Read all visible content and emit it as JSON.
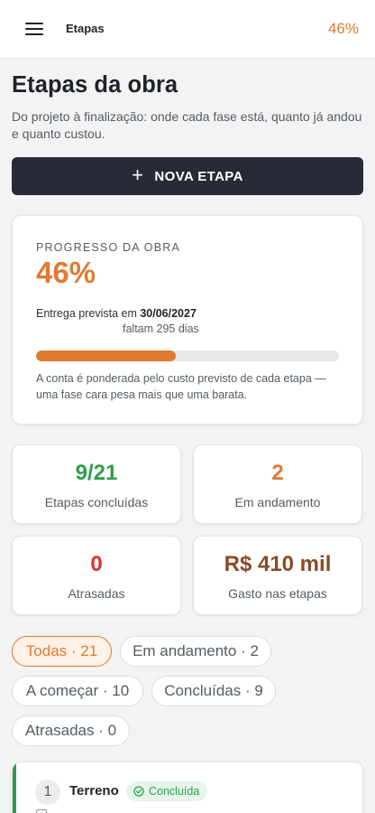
{
  "header": {
    "title": "Etapas",
    "progress": "46%"
  },
  "page": {
    "title": "Etapas da obra",
    "subtitle": "Do projeto à finalização: onde cada fase está, quanto já andou e quanto custou."
  },
  "actions": {
    "new_stage_label": "NOVA ETAPA"
  },
  "progress_card": {
    "label": "PROGRESSO DA OBRA",
    "value": "46%",
    "progress_fraction": 0.46,
    "delivery_prefix": "Entrega prevista em",
    "delivery_date": "30/06/2027",
    "remaining": "faltam 295 dias",
    "note": "A conta é ponderada pelo custo previsto de cada etapa — uma fase cara pesa mais que uma barata."
  },
  "stats": [
    {
      "value": "9/21",
      "label": "Etapas concluídas",
      "color": "#2e9e4a"
    },
    {
      "value": "2",
      "label": "Em andamento",
      "color": "#e07a30"
    },
    {
      "value": "0",
      "label": "Atrasadas",
      "color": "#d83232"
    },
    {
      "value": "R$ 410 mil",
      "label": "Gasto nas etapas",
      "color": "#8b4a24"
    }
  ],
  "filters": [
    {
      "label": "Todas · 21",
      "active": true
    },
    {
      "label": "Em andamento · 2",
      "active": false
    },
    {
      "label": "A começar · 10",
      "active": false
    },
    {
      "label": "Concluídas · 9",
      "active": false
    },
    {
      "label": "Atrasadas · 0",
      "active": false
    }
  ],
  "stages": [
    {
      "number": "1",
      "name": "Terreno",
      "status": "Concluída",
      "status_color": "#2e9e4a"
    }
  ],
  "colors": {
    "accent": "#e07a30",
    "dark_button": "#272b35",
    "success": "#2e9e4a",
    "danger": "#d83232"
  }
}
